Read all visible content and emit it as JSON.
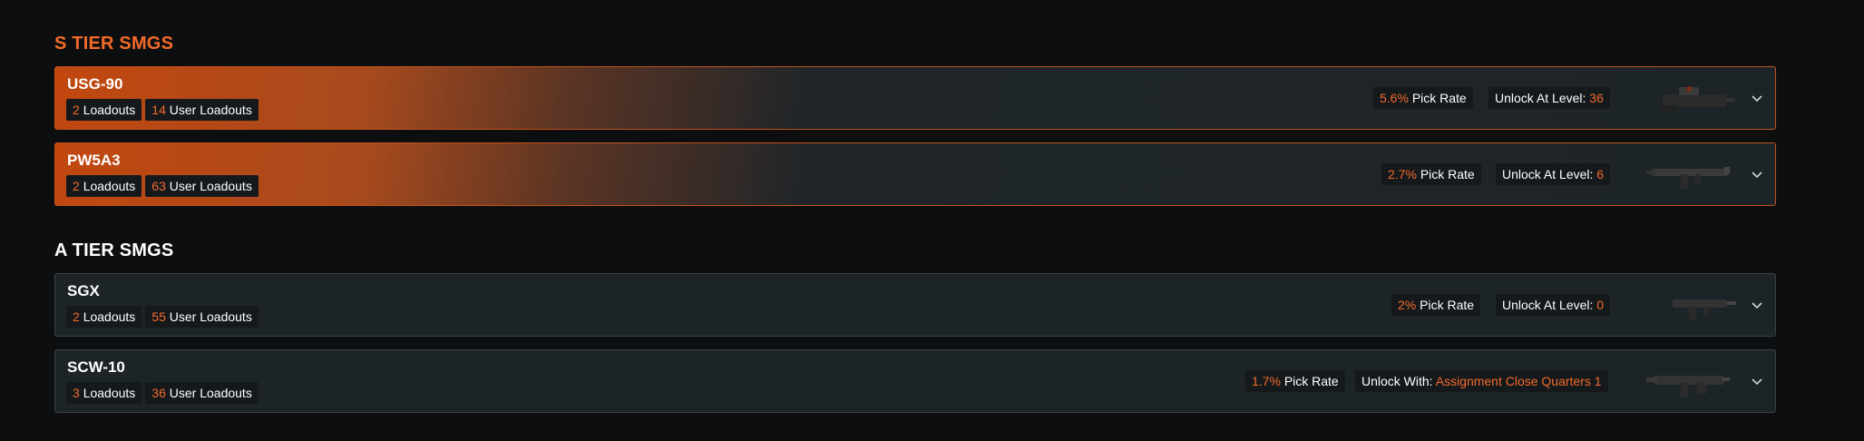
{
  "tiers": [
    {
      "title": "S TIER SMGS",
      "weapons": [
        {
          "name": "USG-90",
          "loadouts": "2",
          "loadouts_label": "Loadouts",
          "user_loadouts": "14",
          "user_loadouts_label": "User Loadouts",
          "pick_rate": "5.6%",
          "pick_rate_label": "Pick Rate",
          "unlock_label": "Unlock At Level:",
          "unlock_value": "36",
          "icon": "smg-usg90-icon"
        },
        {
          "name": "PW5A3",
          "loadouts": "2",
          "loadouts_label": "Loadouts",
          "user_loadouts": "63",
          "user_loadouts_label": "User Loadouts",
          "pick_rate": "2.7%",
          "pick_rate_label": "Pick Rate",
          "unlock_label": "Unlock At Level:",
          "unlock_value": "6",
          "icon": "smg-pw5a3-icon"
        }
      ]
    },
    {
      "title": "A TIER SMGS",
      "weapons": [
        {
          "name": "SGX",
          "loadouts": "2",
          "loadouts_label": "Loadouts",
          "user_loadouts": "55",
          "user_loadouts_label": "User Loadouts",
          "pick_rate": "2%",
          "pick_rate_label": "Pick Rate",
          "unlock_label": "Unlock At Level:",
          "unlock_value": "0",
          "icon": "smg-sgx-icon"
        },
        {
          "name": "SCW-10",
          "loadouts": "3",
          "loadouts_label": "Loadouts",
          "user_loadouts": "36",
          "user_loadouts_label": "User Loadouts",
          "pick_rate": "1.7%",
          "pick_rate_label": "Pick Rate",
          "unlock_label": "Unlock With:",
          "unlock_value": "Assignment Close Quarters 1",
          "icon": "smg-scw10-icon"
        }
      ]
    }
  ],
  "colors": {
    "accent": "#f26b2a",
    "card_bg": "#1d2428",
    "page_bg": "#0d0e0f",
    "badge_bg": "#15191c"
  }
}
